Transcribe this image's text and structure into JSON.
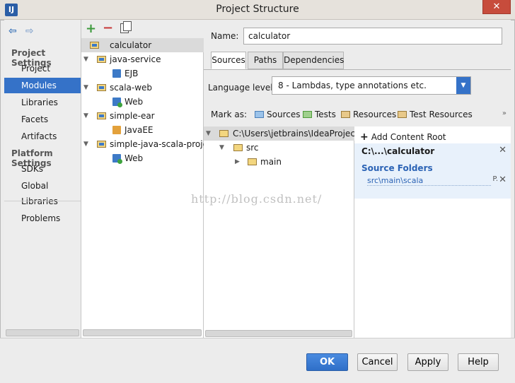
{
  "window": {
    "title": "Project Structure",
    "app_icon": "IJ",
    "close_glyph": "✕"
  },
  "nav": {
    "back_glyph": "⇦",
    "forward_glyph": "⇨"
  },
  "sidebar": {
    "project_settings_title": "Project Settings",
    "project_items": [
      "Project",
      "Modules",
      "Libraries",
      "Facets",
      "Artifacts"
    ],
    "platform_settings_title": "Platform Settings",
    "platform_items": [
      "SDKs",
      "Global Libraries"
    ],
    "problems": "Problems",
    "selected": "Modules"
  },
  "modules_toolbar": {
    "add": "+",
    "remove": "−"
  },
  "modules": [
    {
      "label": "calculator",
      "kind": "module",
      "selected": true
    },
    {
      "label": "java-service",
      "kind": "module"
    },
    {
      "label": "EJB",
      "kind": "facet"
    },
    {
      "label": "scala-web",
      "kind": "module"
    },
    {
      "label": "Web",
      "kind": "facet"
    },
    {
      "label": "simple-ear",
      "kind": "module"
    },
    {
      "label": "JavaEE",
      "kind": "facet"
    },
    {
      "label": "simple-java-scala-project",
      "kind": "module"
    },
    {
      "label": "Web",
      "kind": "facet"
    }
  ],
  "module_form": {
    "name_label": "Name:",
    "name_value": "calculator",
    "tabs": [
      "Sources",
      "Paths",
      "Dependencies"
    ],
    "active_tab": "Sources",
    "language_level_label": "Language level:",
    "language_level_value": "8 - Lambdas, type annotations etc.",
    "mark_as_label": "Mark as:",
    "mark_as": [
      "Sources",
      "Tests",
      "Resources",
      "Test Resources"
    ],
    "overflow_glyph": "»"
  },
  "file_tree": [
    {
      "label": "C:\\Users\\jetbrains\\IdeaProjects\\s",
      "expanded": true
    },
    {
      "label": "src",
      "expanded": true
    },
    {
      "label": "main",
      "expanded": false
    }
  ],
  "content_roots": {
    "add_label": "Add Content Root",
    "root_path": "C:\\...\\calculator",
    "source_folders_title": "Source Folders",
    "source_folder": "src\\main\\scala",
    "edit_glyph": "P.",
    "close_glyph": "✕"
  },
  "watermark": "http://blog.csdn.net/",
  "footer": {
    "ok": "OK",
    "cancel": "Cancel",
    "apply": "Apply",
    "help": "Help"
  },
  "colors": {
    "selection": "#3572c8",
    "primary_button": "#3a7bd5",
    "link": "#2b63b5"
  }
}
